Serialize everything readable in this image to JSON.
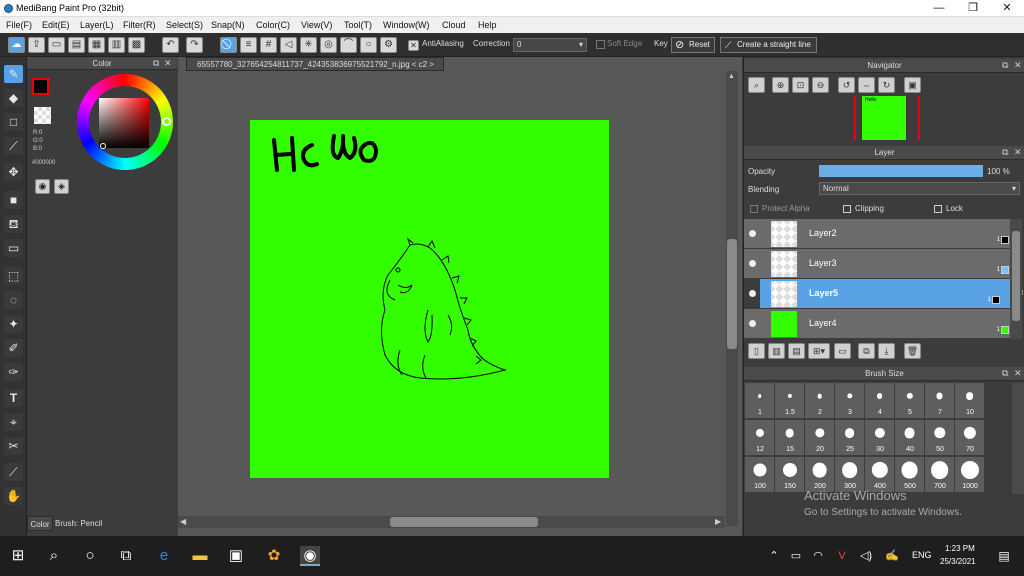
{
  "window": {
    "title": "MediBang Paint Pro (32bit)",
    "min": "—",
    "max": "❐",
    "close": "✕"
  },
  "menu": [
    "File(F)",
    "Edit(E)",
    "Layer(L)",
    "Filter(R)",
    "Select(S)",
    "Snap(N)",
    "Color(C)",
    "View(V)",
    "Tool(T)",
    "Window(W)",
    "Cloud",
    "Help"
  ],
  "toolbar": {
    "antialiasing_label": "AntiAliasing",
    "correction_label": "Correction",
    "correction_value": "0",
    "soft_edge_label": "Soft Edge",
    "key_label": "Key",
    "reset_label": "Reset",
    "straight_line_label": "Create a straight line"
  },
  "color_panel": {
    "title": "Color",
    "r": "R:0",
    "g": "G:0",
    "b": "B:0",
    "hex": "#000000",
    "foreground": "#000000"
  },
  "left_bottom": {
    "color_tab": "Color",
    "brush_tab": "Brush: Pencil"
  },
  "document": {
    "tab_label": "65557780_327654254811737_4243538369755217​92_n.jpg  < c2 >",
    "canvas_color": "#33ff00",
    "canvas_text": "Hello"
  },
  "navigator": {
    "title": "Navigator"
  },
  "layer_panel": {
    "title": "Layer",
    "opacity_label": "Opacity",
    "opacity_value": "100 %",
    "opacity_fraction": 1.0,
    "blending_label": "Blending",
    "blending_value": "Normal",
    "protect_alpha": "Protect Alpha",
    "clipping": "Clipping",
    "lock": "Lock",
    "layers": [
      {
        "name": "Layer2",
        "num": "1",
        "swatch": "#000000"
      },
      {
        "name": "Layer3",
        "num": "1",
        "swatch": "#7fbfff"
      },
      {
        "name": "Layer5",
        "num": "1",
        "swatch": "#000000",
        "selected": true
      },
      {
        "name": "Layer4",
        "num": "1",
        "swatch": "#33ff00"
      }
    ]
  },
  "brush_size": {
    "title": "Brush Size",
    "sizes": [
      "1",
      "1.5",
      "2",
      "3",
      "4",
      "5",
      "7",
      "10",
      "12",
      "15",
      "20",
      "25",
      "30",
      "40",
      "50",
      "70",
      "100",
      "150",
      "200",
      "300",
      "400",
      "500",
      "700",
      "1000"
    ]
  },
  "watermark": {
    "line1": "Activate Windows",
    "line2": "Go to Settings to activate Windows."
  },
  "taskbar": {
    "time": "1:23 PM",
    "date": "25/3/2021",
    "lang": "ENG"
  }
}
